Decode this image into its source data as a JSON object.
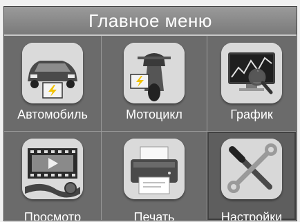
{
  "header": {
    "title": "Главное меню"
  },
  "menu": {
    "items": [
      {
        "label": "Автомобиль",
        "icon": "car-icon"
      },
      {
        "label": "Мотоцикл",
        "icon": "motorcycle-icon"
      },
      {
        "label": "График",
        "icon": "graph-icon"
      },
      {
        "label": "Просмотр",
        "icon": "film-playback-icon"
      },
      {
        "label": "Печать",
        "icon": "printer-icon"
      },
      {
        "label": "Настройки",
        "icon": "tools-icon"
      }
    ],
    "selected": "Настройки"
  },
  "colors": {
    "background": "#6d6d6d",
    "title_bar": "#8a8a8a",
    "text": "#ffffff",
    "battery_yellow": "#f2c200"
  }
}
